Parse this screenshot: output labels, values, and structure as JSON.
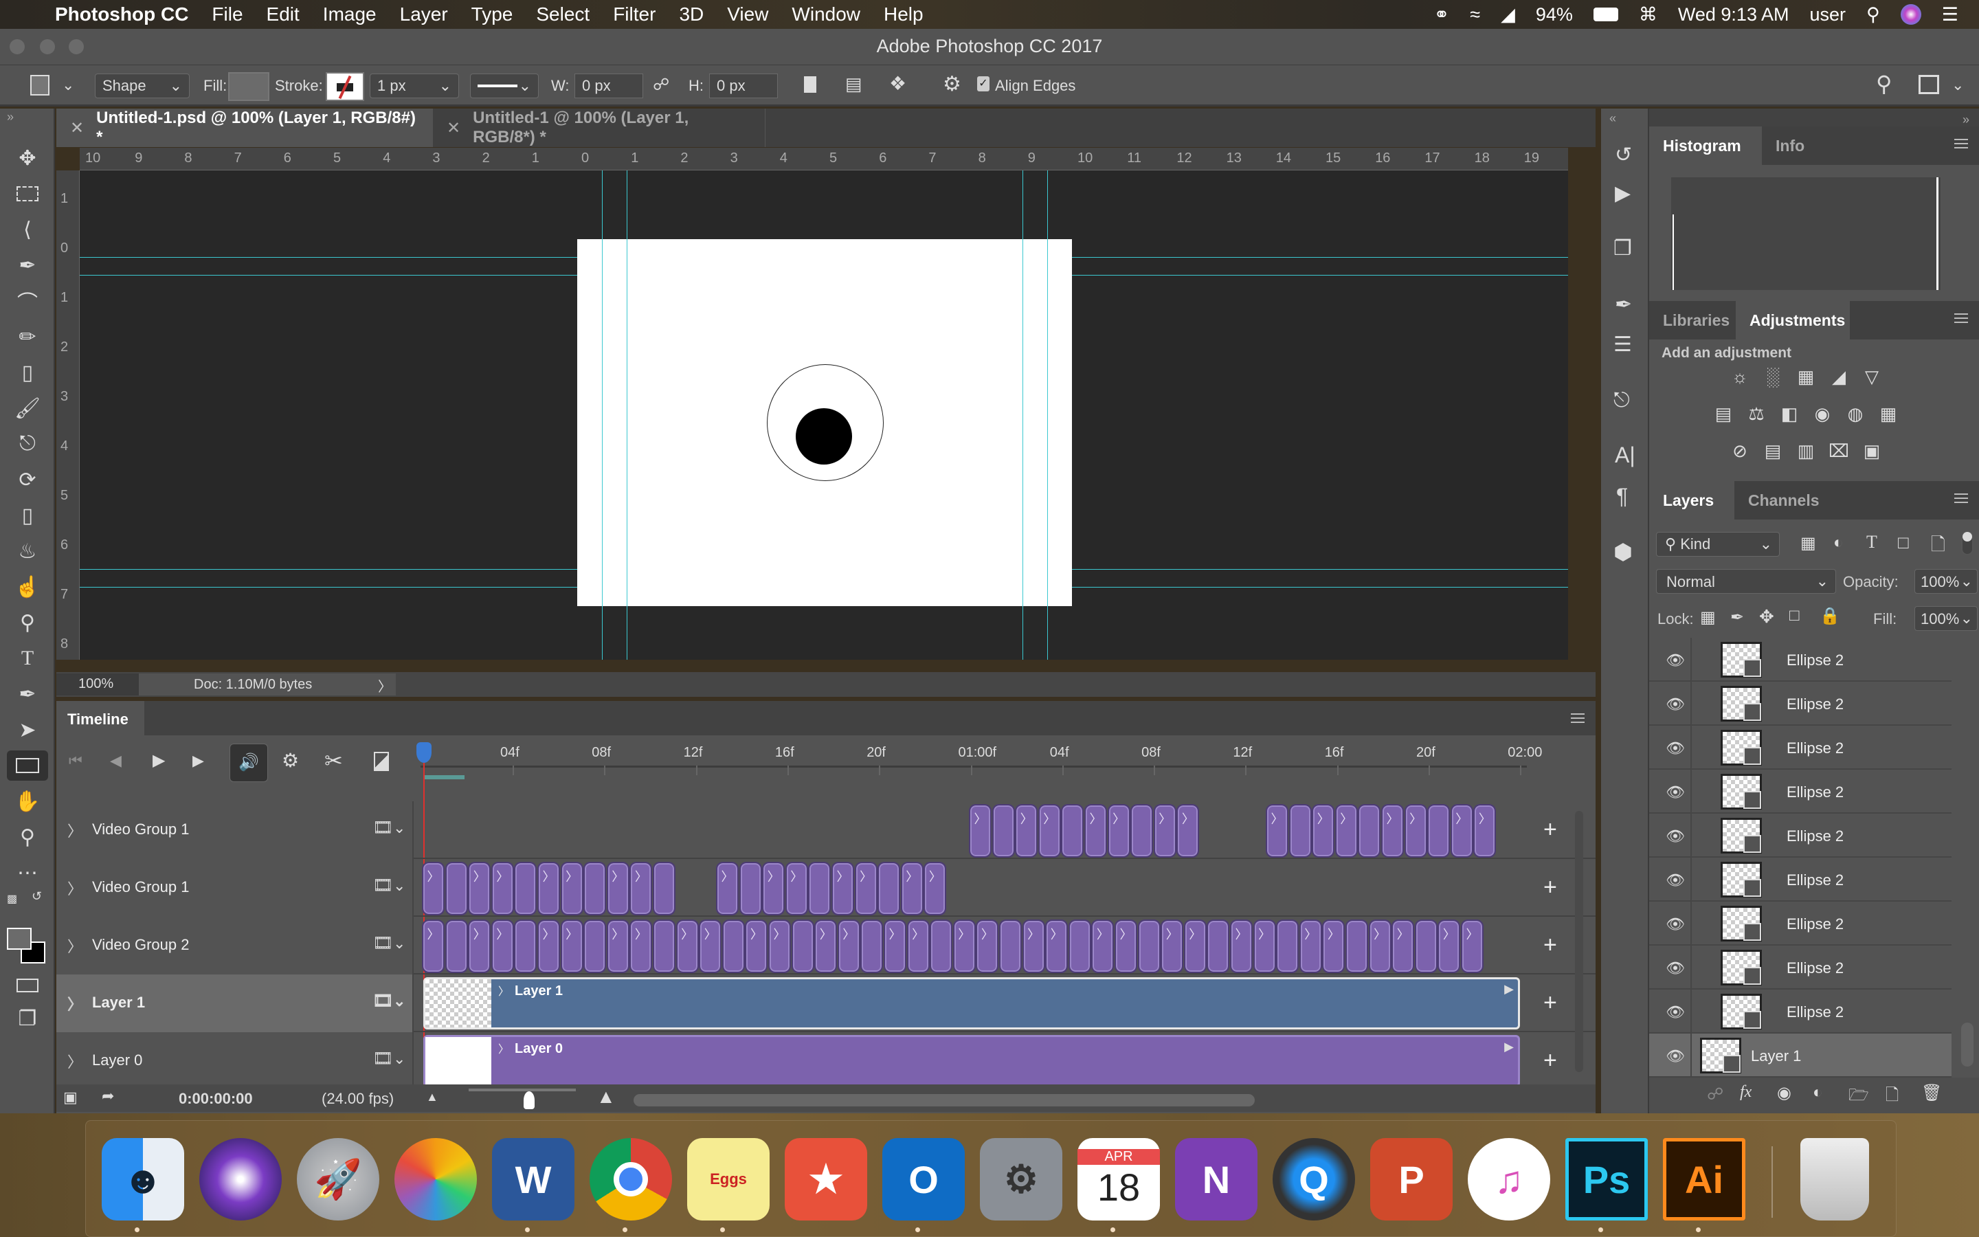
{
  "menubar": {
    "app_name": "Photoshop CC",
    "items": [
      "File",
      "Edit",
      "Image",
      "Layer",
      "Type",
      "Select",
      "Filter",
      "3D",
      "View",
      "Window",
      "Help"
    ],
    "battery": "94%",
    "clock": "Wed 9:13 AM",
    "user": "user"
  },
  "window": {
    "title": "Adobe Photoshop CC 2017"
  },
  "options": {
    "mode": "Shape",
    "fill_label": "Fill:",
    "stroke_label": "Stroke:",
    "stroke_width": "1 px",
    "w_label": "W:",
    "w_value": "0 px",
    "h_label": "H:",
    "h_value": "0 px",
    "align_edges_label": "Align Edges",
    "align_edges_checked": true
  },
  "doc_tabs": [
    {
      "label": "Untitled-1.psd @ 100% (Layer 1, RGB/8#) *",
      "active": true
    },
    {
      "label": "Untitled-1 @ 100% (Layer 1, RGB/8*) *",
      "active": false
    }
  ],
  "rulers": {
    "horizontal": [
      "10",
      "9",
      "8",
      "7",
      "6",
      "5",
      "4",
      "3",
      "2",
      "1",
      "0",
      "1",
      "2",
      "3",
      "4",
      "5",
      "6",
      "7",
      "8",
      "9",
      "10",
      "11",
      "12",
      "13",
      "14",
      "15",
      "16",
      "17",
      "18",
      "19"
    ],
    "vertical": [
      "1",
      "0",
      "1",
      "2",
      "3",
      "4",
      "5",
      "6",
      "7",
      "8"
    ]
  },
  "status": {
    "zoom": "100%",
    "doc_info": "Doc: 1.10M/0 bytes"
  },
  "timeline": {
    "title": "Timeline",
    "ruler_labels": [
      "04f",
      "08f",
      "12f",
      "16f",
      "20f",
      "01:00f",
      "04f",
      "08f",
      "12f",
      "16f",
      "20f",
      "02:00"
    ],
    "tracks": [
      {
        "name": "Video Group 1",
        "selected": false
      },
      {
        "name": "Video Group 1",
        "selected": false
      },
      {
        "name": "Video Group 2",
        "selected": false
      },
      {
        "name": "Layer 1",
        "selected": true,
        "clip_label": "Layer 1"
      },
      {
        "name": "Layer 0",
        "selected": false,
        "clip_label": "Layer 0"
      }
    ],
    "timecode": "0:00:00:00",
    "fps": "(24.00 fps)"
  },
  "panels": {
    "histogram_tabs": [
      "Histogram",
      "Info"
    ],
    "adjust_tabs": [
      "Libraries",
      "Adjustments"
    ],
    "add_adjustment": "Add an adjustment",
    "layers_tabs": [
      "Layers",
      "Channels"
    ],
    "filter_kind": "Kind",
    "blend_mode": "Normal",
    "opacity_label": "Opacity:",
    "opacity": "100%",
    "lock_label": "Lock:",
    "fill_label": "Fill:",
    "fill": "100%",
    "layers": [
      {
        "name": "Ellipse 2",
        "visible": true,
        "selected": false
      },
      {
        "name": "Ellipse 2",
        "visible": true,
        "selected": false
      },
      {
        "name": "Ellipse 2",
        "visible": true,
        "selected": false
      },
      {
        "name": "Ellipse 2",
        "visible": true,
        "selected": false
      },
      {
        "name": "Ellipse 2",
        "visible": true,
        "selected": false
      },
      {
        "name": "Ellipse 2",
        "visible": true,
        "selected": false
      },
      {
        "name": "Ellipse 2",
        "visible": true,
        "selected": false
      },
      {
        "name": "Ellipse 2",
        "visible": true,
        "selected": false
      },
      {
        "name": "Ellipse 2",
        "visible": true,
        "selected": false
      },
      {
        "name": "Layer 1",
        "visible": true,
        "selected": true
      }
    ]
  },
  "dock": {
    "apps": [
      "Finder",
      "Siri",
      "Launchpad",
      "Photos",
      "Microsoft Word",
      "Google Chrome",
      "Stickies",
      "Wunderlist",
      "Microsoft Outlook",
      "System Preferences",
      "Calendar",
      "Microsoft OneNote",
      "QuickTime Player",
      "Microsoft PowerPoint",
      "iTunes",
      "Adobe Photoshop CC",
      "Adobe Illustrator",
      "Trash"
    ],
    "calendar_month": "APR",
    "calendar_day": "18"
  },
  "colors": {
    "clip_purple": "#7c62ad",
    "clip_blue": "#516f96",
    "guide": "#3cc8d0",
    "playhead": "#e0312e"
  }
}
